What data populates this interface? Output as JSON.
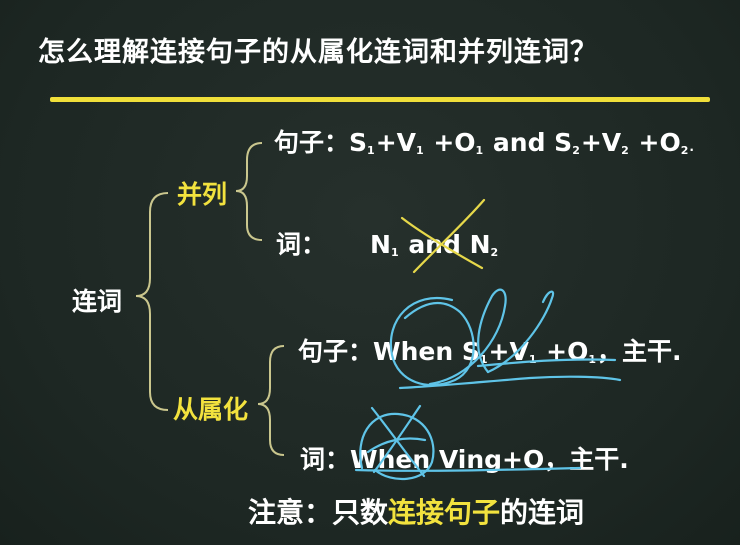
{
  "title": "怎么理解连接句子的从属化连词和并列连词？",
  "root_label": "连词",
  "branches": {
    "coordinate": {
      "label": "并列",
      "sentence": {
        "prefix": "句子：",
        "formula_parts": [
          "S",
          "1",
          "+V",
          "1",
          " +O",
          "1",
          " and S",
          "2",
          "+V",
          "2",
          " +O",
          "2",
          "."
        ]
      },
      "word": {
        "prefix": "词：",
        "formula_parts": [
          "N",
          "1",
          " and N",
          "2"
        ]
      }
    },
    "subordinate": {
      "label": "从属化",
      "sentence": {
        "prefix": "句子：",
        "formula_parts": [
          "When S",
          "1",
          "+V",
          "1",
          " +O",
          "1",
          "，主干."
        ]
      },
      "word": {
        "prefix": "词：",
        "formula_parts": [
          "When Ving+O",
          "，主干."
        ]
      }
    }
  },
  "note": {
    "part1": "注意：只数",
    "part2": "连接句子",
    "part3": "的连词"
  },
  "colors": {
    "board": "#1f2a26",
    "highlight_yellow": "#f2e23e",
    "annotation_blue": "#5fc4e8",
    "cross_yellow": "#e6d84a"
  }
}
